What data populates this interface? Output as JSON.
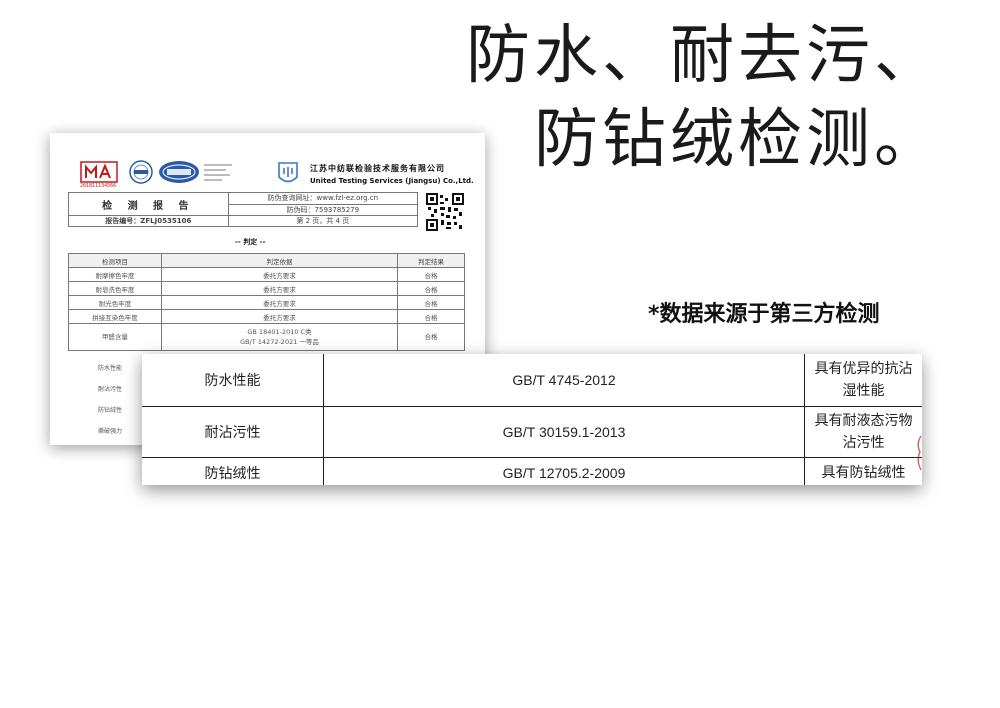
{
  "headline": {
    "line1": "防水、耐去污、",
    "line2": "防钻绒检测。"
  },
  "source_note": "*数据来源于第三方检测",
  "report": {
    "cma_caption": "201811134566",
    "company_cn": "江苏中纺联检验技术服务有限公司",
    "company_en": "United Testing Services (Jiangsu) Co.,Ltd.",
    "title": "检 测 报 告",
    "anti_fake_url": "防伪查询网址：www.fzl-ez.org.cn",
    "anti_fake_code": "防伪码：7593785279",
    "report_no": "报告编号：ZFLJ0535106",
    "page_info": "第 2 页，共 4 页",
    "verdict": "-- 判定 --",
    "columns": [
      "检测项目",
      "判定依据",
      "判定结果"
    ],
    "rows": [
      {
        "item": "耐摩擦色牢度",
        "basis": "委托方要求",
        "result": "合格"
      },
      {
        "item": "耐皂洗色牢度",
        "basis": "委托方要求",
        "result": "合格"
      },
      {
        "item": "耐光色牢度",
        "basis": "委托方要求",
        "result": "合格"
      },
      {
        "item": "拼接互染色牢度",
        "basis": "委托方要求",
        "result": "合格"
      },
      {
        "item": "甲醛含量",
        "basis_line1": "GB 18401-2010 C类",
        "basis_line2": "GB/T 14272-2021 一等品",
        "result": "合格"
      }
    ],
    "side_labels": [
      "防水性能",
      "耐沾污性",
      "防钻绒性",
      "撕破强力"
    ]
  },
  "zoom_table": {
    "rows": [
      {
        "name": "防水性能",
        "standard": "GB/T 4745-2012",
        "result": "具有优异的抗沾湿性能"
      },
      {
        "name": "耐沾污性",
        "standard": "GB/T 30159.1-2013",
        "result": "具有耐液态污物沾污性"
      },
      {
        "name": "防钻绒性",
        "standard": "GB/T 12705.2-2009",
        "result": "具有防钻绒性"
      }
    ]
  },
  "colors": {
    "cma_red": "#c21a1a",
    "cnas_blue": "#2a5aa8",
    "uts_blue": "#3a7abf"
  }
}
